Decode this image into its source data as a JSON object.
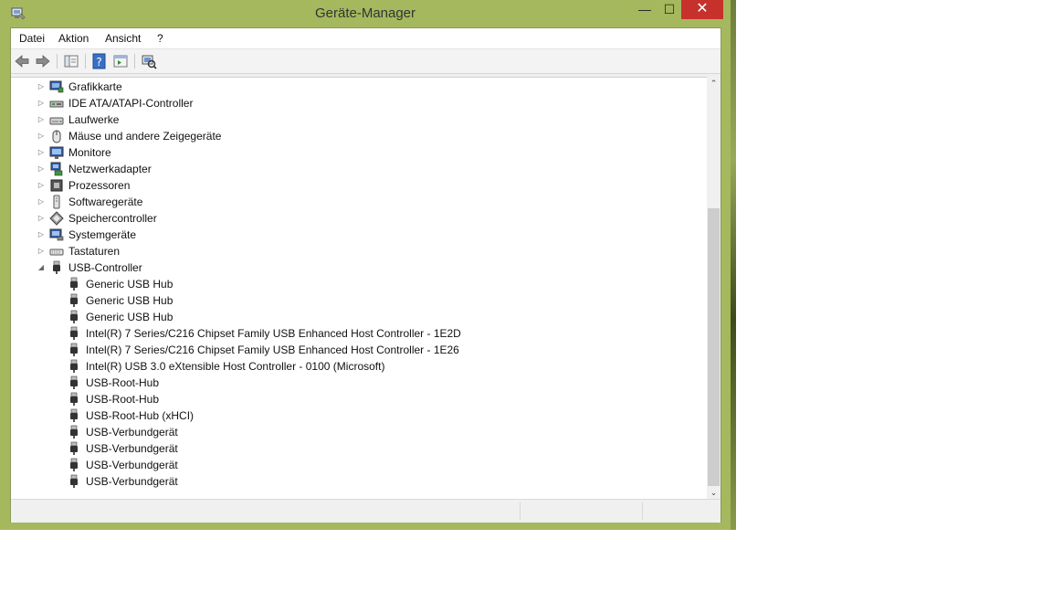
{
  "window": {
    "title": "Geräte-Manager",
    "min_symbol": "—",
    "max_symbol": "☐",
    "close_symbol": "✕"
  },
  "menu": {
    "items": [
      "Datei",
      "Aktion",
      "Ansicht",
      "?"
    ]
  },
  "toolbar": {
    "icons": [
      "back-arrow-icon",
      "forward-arrow-icon",
      "show-hide-tree-icon",
      "help-icon",
      "properties-icon",
      "scan-hardware-icon"
    ]
  },
  "tree": {
    "items": [
      {
        "label": "Grafikkarte",
        "level": 0,
        "expander": "▷",
        "icon": "display-adapter-icon"
      },
      {
        "label": "IDE ATA/ATAPI-Controller",
        "level": 0,
        "expander": "▷",
        "icon": "ide-controller-icon"
      },
      {
        "label": "Laufwerke",
        "level": 0,
        "expander": "▷",
        "icon": "disk-drive-icon"
      },
      {
        "label": "Mäuse und andere Zeigegeräte",
        "level": 0,
        "expander": "▷",
        "icon": "mouse-icon"
      },
      {
        "label": "Monitore",
        "level": 0,
        "expander": "▷",
        "icon": "monitor-icon"
      },
      {
        "label": "Netzwerkadapter",
        "level": 0,
        "expander": "▷",
        "icon": "network-adapter-icon"
      },
      {
        "label": "Prozessoren",
        "level": 0,
        "expander": "▷",
        "icon": "processor-icon"
      },
      {
        "label": "Softwaregeräte",
        "level": 0,
        "expander": "▷",
        "icon": "software-device-icon"
      },
      {
        "label": "Speichercontroller",
        "level": 0,
        "expander": "▷",
        "icon": "storage-controller-icon"
      },
      {
        "label": "Systemgeräte",
        "level": 0,
        "expander": "▷",
        "icon": "system-device-icon"
      },
      {
        "label": "Tastaturen",
        "level": 0,
        "expander": "▷",
        "icon": "keyboard-icon"
      },
      {
        "label": "USB-Controller",
        "level": 0,
        "expander": "◢",
        "icon": "usb-icon"
      },
      {
        "label": "Generic USB Hub",
        "level": 1,
        "expander": "",
        "icon": "usb-icon"
      },
      {
        "label": "Generic USB Hub",
        "level": 1,
        "expander": "",
        "icon": "usb-icon"
      },
      {
        "label": "Generic USB Hub",
        "level": 1,
        "expander": "",
        "icon": "usb-icon"
      },
      {
        "label": "Intel(R) 7 Series/C216 Chipset Family USB Enhanced Host Controller - 1E2D",
        "level": 1,
        "expander": "",
        "icon": "usb-icon"
      },
      {
        "label": "Intel(R) 7 Series/C216 Chipset Family USB Enhanced Host Controller - 1E26",
        "level": 1,
        "expander": "",
        "icon": "usb-icon"
      },
      {
        "label": "Intel(R) USB 3.0 eXtensible Host Controller - 0100 (Microsoft)",
        "level": 1,
        "expander": "",
        "icon": "usb-icon"
      },
      {
        "label": "USB-Root-Hub",
        "level": 1,
        "expander": "",
        "icon": "usb-icon"
      },
      {
        "label": "USB-Root-Hub",
        "level": 1,
        "expander": "",
        "icon": "usb-icon"
      },
      {
        "label": "USB-Root-Hub (xHCI)",
        "level": 1,
        "expander": "",
        "icon": "usb-icon"
      },
      {
        "label": "USB-Verbundgerät",
        "level": 1,
        "expander": "",
        "icon": "usb-icon"
      },
      {
        "label": "USB-Verbundgerät",
        "level": 1,
        "expander": "",
        "icon": "usb-icon"
      },
      {
        "label": "USB-Verbundgerät",
        "level": 1,
        "expander": "",
        "icon": "usb-icon"
      },
      {
        "label": "USB-Verbundgerät",
        "level": 1,
        "expander": "",
        "icon": "usb-icon"
      }
    ]
  },
  "scrollbar": {
    "up_symbol": "⌃",
    "down_symbol": "⌄",
    "position_fraction": 0.3,
    "visible_fraction": 0.7
  },
  "colors": {
    "window_frame": "#a5b85e",
    "close_button": "#c7312c"
  }
}
